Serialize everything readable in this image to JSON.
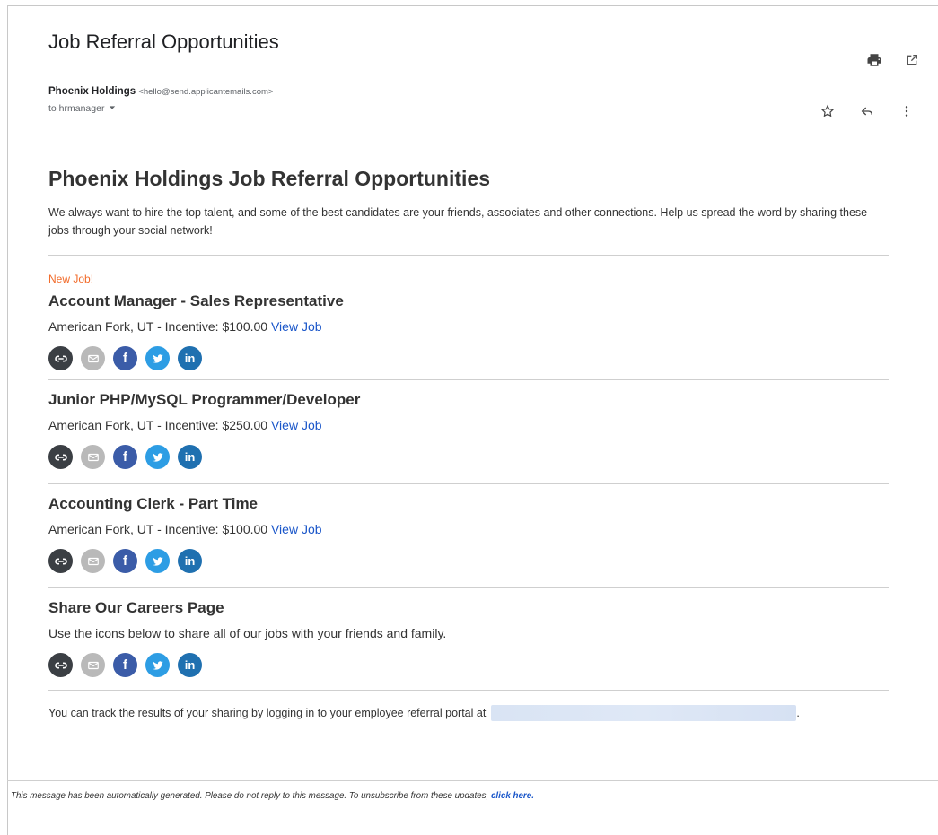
{
  "header": {
    "subject": "Job Referral Opportunities",
    "sender_name": "Phoenix Holdings",
    "sender_email": "<hello@send.applicantemails.com>",
    "to_label": "to hrmanager"
  },
  "email": {
    "heading": "Phoenix Holdings Job Referral Opportunities",
    "intro": "We always want to hire the top talent, and some of the best candidates are your friends, associates and other connections. Help us spread the word by sharing these jobs through your social network!",
    "new_job_badge": "New Job!",
    "view_job_label": "View Job",
    "jobs": [
      {
        "title": "Account Manager - Sales Representative",
        "meta": "American Fork, UT - Incentive: $100.00"
      },
      {
        "title": "Junior PHP/MySQL Programmer/Developer",
        "meta": "American Fork, UT - Incentive: $250.00"
      },
      {
        "title": "Accounting Clerk - Part Time",
        "meta": "American Fork, UT - Incentive: $100.00"
      }
    ],
    "share": {
      "title": "Share Our Careers Page",
      "text": "Use the icons below to share all of our jobs with your friends and family."
    },
    "track_text": "You can track the results of your sharing by logging in to your employee referral portal at",
    "track_end": "."
  },
  "footer": {
    "text": "This message has been automatically generated. Please do not reply to this message. To unsubscribe from these updates,",
    "link": "click here."
  },
  "icons": {
    "print": "print-icon",
    "open": "open-in-new-icon",
    "star": "star-icon",
    "reply": "reply-icon",
    "more": "more-vert-icon",
    "link": "link-icon",
    "mail": "email-icon",
    "facebook": "facebook-icon",
    "twitter": "twitter-icon",
    "linkedin": "linkedin-icon"
  },
  "colors": {
    "accent_link": "#1a56c9",
    "new_job": "#f26b2a"
  }
}
